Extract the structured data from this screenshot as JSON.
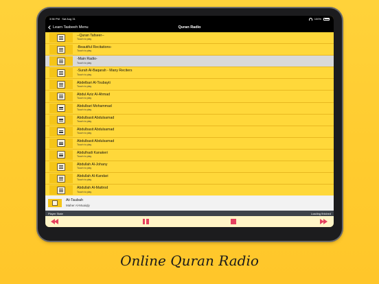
{
  "status": {
    "time": "3:56 PM",
    "date": "Sat Aug 31",
    "battery": "100%"
  },
  "nav": {
    "back_label": "Learn Tasbeeh Menu",
    "title": "Quran Radio"
  },
  "stations": [
    {
      "title": "--Quran Tafseer--",
      "subtitle": "Touch to play"
    },
    {
      "title": "-Beautiful Recitations-",
      "subtitle": "Touch to play"
    },
    {
      "title": "-Main Radio-",
      "subtitle": "Touch to play"
    },
    {
      "title": "-Surah Al-Baqarah - Many Reciters",
      "subtitle": "Touch to play"
    },
    {
      "title": "Abdelbari Al-Toubayti",
      "subtitle": "Touch to play"
    },
    {
      "title": "Abdul Aziz Al-Ahmad",
      "subtitle": "Touch to play"
    },
    {
      "title": "Abdulbari Mohammad",
      "subtitle": "Touch to play"
    },
    {
      "title": "Abdulbasit Abdulsamad",
      "subtitle": "Touch to play"
    },
    {
      "title": "Abdulbasit Abdulsamad",
      "subtitle": "Touch to play"
    },
    {
      "title": "Abdulbasit Abdulsamad",
      "subtitle": "Touch to play"
    },
    {
      "title": "Abdulhadi Kanakeri",
      "subtitle": "Touch to play"
    },
    {
      "title": "Abdullah Al-Johany",
      "subtitle": "Touch to play"
    },
    {
      "title": "Abdullah Al-Kandari",
      "subtitle": "Touch to play"
    },
    {
      "title": "Abdullah Al-Mattrod",
      "subtitle": "Touch to play"
    }
  ],
  "now_playing": {
    "title": "At-Taubah",
    "reciter": "Maher Al-Muaiqly"
  },
  "player": {
    "state_label": "Player State",
    "state_value": "Loading finished"
  },
  "caption": "Online Quran Radio",
  "colors": {
    "accent": "#e4405f",
    "background": "#ffd83a"
  }
}
